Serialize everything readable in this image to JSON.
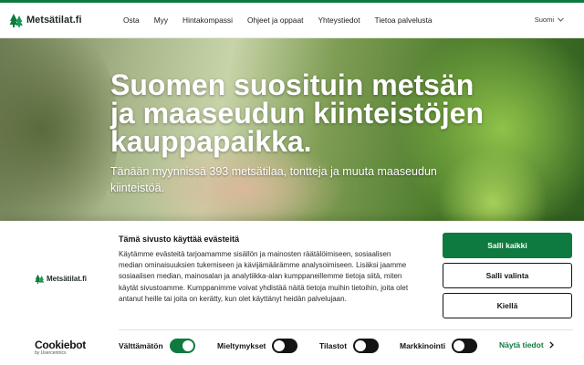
{
  "header": {
    "logo_text": "Metsätilat.fi",
    "nav": [
      "Osta",
      "Myy",
      "Hintakompassi",
      "Ohjeet ja oppaat",
      "Yhteystiedot",
      "Tietoa palvelusta"
    ],
    "language": "Suomi"
  },
  "hero": {
    "title": "Suomen suosituin metsän ja maaseudun kiinteistöjen kauppapaikka.",
    "subtitle": "Tänään myynnissä 393 metsätilaa, tontteja ja muuta maaseudun kiinteistöä."
  },
  "cookie": {
    "logo_text": "Metsätilat.fi",
    "brand_main": "Cookiebot",
    "brand_sub": "by Usercentrics",
    "title": "Tämä sivusto käyttää evästeitä",
    "body": "Käytämme evästeitä tarjoamamme sisällön ja mainosten räätälöimiseen, sosiaalisen median ominaisuuksien tukemiseen ja kävijämäärämme analysoimiseen. Lisäksi jaamme sosiaalisen median, mainosalan ja analytiikka-alan kumppaneillemme tietoja siitä, miten käytät sivustoamme. Kumppanimme voivat yhdistää näitä tietoja muihin tietoihin, joita olet antanut heille tai joita on kerätty, kun olet käyttänyt heidän palvelujaan.",
    "buttons": {
      "allow_all": "Salli kaikki",
      "allow_selection": "Salli valinta",
      "deny": "Kiellä"
    },
    "toggles": [
      {
        "label": "Välttämätön",
        "on": true
      },
      {
        "label": "Mieltymykset",
        "on": false
      },
      {
        "label": "Tilastot",
        "on": false
      },
      {
        "label": "Markkinointi",
        "on": false
      }
    ],
    "details_link": "Näytä tiedot"
  },
  "colors": {
    "brand_green": "#0f7a3f",
    "text_dark": "#141414"
  }
}
